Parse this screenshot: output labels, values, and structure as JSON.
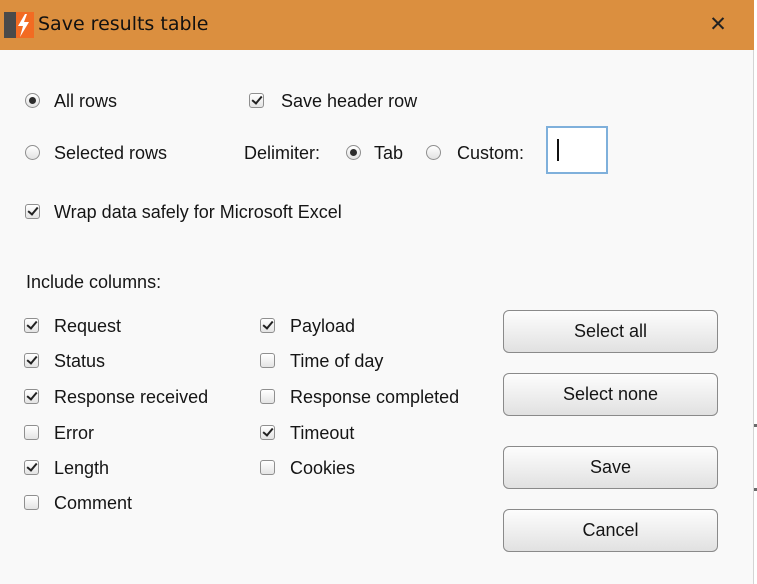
{
  "window": {
    "title": "Save results table",
    "close_glyph": "✕",
    "colors": {
      "titlebar": "#db8f3f",
      "body": "#f9f9f9",
      "input_border": "#7fb0db"
    }
  },
  "app_icon": "burp-suite-icon",
  "rows_option": {
    "all_rows": {
      "label": "All rows",
      "selected": true
    },
    "selected_rows": {
      "label": "Selected rows",
      "selected": false
    }
  },
  "save_header_row": {
    "label": "Save header row",
    "checked": true
  },
  "delimiter": {
    "label": "Delimiter:",
    "tab": {
      "label": "Tab",
      "selected": true
    },
    "custom": {
      "label": "Custom:",
      "selected": false
    },
    "custom_value": ""
  },
  "wrap_excel": {
    "label": "Wrap data safely for Microsoft Excel",
    "checked": true
  },
  "include_columns": {
    "label": "Include columns:",
    "columns": [
      {
        "label": "Request",
        "checked": true
      },
      {
        "label": "Status",
        "checked": true
      },
      {
        "label": "Response received",
        "checked": true
      },
      {
        "label": "Error",
        "checked": false
      },
      {
        "label": "Length",
        "checked": true
      },
      {
        "label": "Comment",
        "checked": false
      },
      {
        "label": "Payload",
        "checked": true
      },
      {
        "label": "Time of day",
        "checked": false
      },
      {
        "label": "Response completed",
        "checked": false
      },
      {
        "label": "Timeout",
        "checked": true
      },
      {
        "label": "Cookies",
        "checked": false
      }
    ]
  },
  "buttons": {
    "select_all": "Select all",
    "select_none": "Select none",
    "save": "Save",
    "cancel": "Cancel"
  }
}
